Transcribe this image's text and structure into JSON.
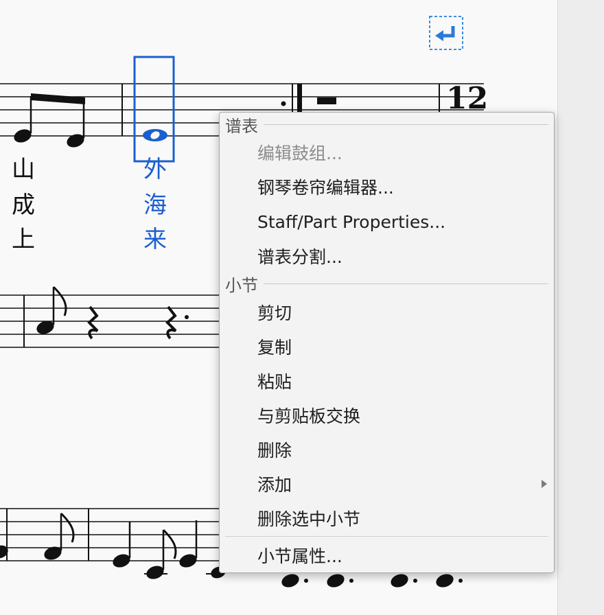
{
  "lyrics": {
    "column1": [
      "山",
      "成",
      "上"
    ],
    "column2": [
      "外",
      "海",
      "来"
    ]
  },
  "measure_number": "12",
  "colors": {
    "selection": "#1a5fd0",
    "menu_background": "#f3f3f3",
    "disabled_text": "#8c8c8c"
  },
  "icons": {
    "line_break": "return-arrow-icon",
    "submenu": "chevron-right-icon"
  },
  "context_menu": {
    "staff_section": {
      "title": "谱表",
      "items": [
        {
          "label": "编辑鼓组...",
          "enabled": false
        },
        {
          "label": "钢琴卷帘编辑器...",
          "enabled": true
        },
        {
          "label": "Staff/Part Properties...",
          "enabled": true
        },
        {
          "label": "谱表分割...",
          "enabled": true
        }
      ]
    },
    "measure_section": {
      "title": "小节",
      "items": [
        {
          "label": "剪切",
          "enabled": true
        },
        {
          "label": "复制",
          "enabled": true
        },
        {
          "label": "粘贴",
          "enabled": true
        },
        {
          "label": "与剪贴板交换",
          "enabled": true
        },
        {
          "label": "删除",
          "enabled": true
        },
        {
          "label": "添加",
          "enabled": true,
          "submenu": true
        },
        {
          "label": "删除选中小节",
          "enabled": true
        }
      ]
    },
    "footer_item": {
      "label": "小节属性...",
      "enabled": true
    }
  }
}
